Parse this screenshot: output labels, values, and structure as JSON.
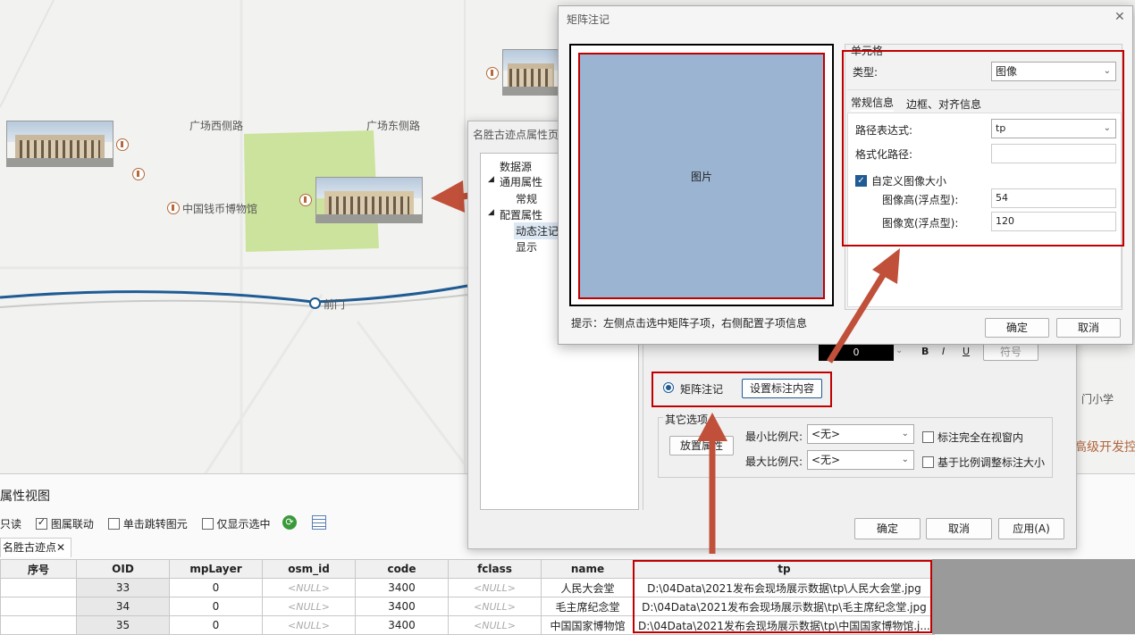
{
  "map": {
    "labels": {
      "west_road": "广场西侧路",
      "east_road": "广场东侧路",
      "museum": "中国钱币博物馆",
      "station": "前门",
      "school": "门小学",
      "adv": "高级开发控"
    }
  },
  "attr_view": {
    "title": "属性视图",
    "toolbar": {
      "readonly": "只读",
      "link": "图属联动",
      "click_jump": "单击跳转图元",
      "only_selected": "仅显示选中"
    },
    "tab": "名胜古迹点",
    "columns": [
      "序号",
      "OID",
      "mpLayer",
      "osm_id",
      "code",
      "fclass",
      "name",
      "tp"
    ],
    "rows": [
      [
        "",
        "33",
        "0",
        "<NULL>",
        "3400",
        "<NULL>",
        "人民大会堂",
        "D:\\04Data\\2021发布会现场展示数据\\tp\\人民大会堂.jpg"
      ],
      [
        "",
        "34",
        "0",
        "<NULL>",
        "3400",
        "<NULL>",
        "毛主席纪念堂",
        "D:\\04Data\\2021发布会现场展示数据\\tp\\毛主席纪念堂.jpg"
      ],
      [
        "",
        "35",
        "0",
        "<NULL>",
        "3400",
        "<NULL>",
        "中国国家博物馆",
        "D:\\04Data\\2021发布会现场展示数据\\tp\\中国国家博物馆.j..."
      ]
    ]
  },
  "prop_dialog": {
    "title": "名胜古迹点属性页",
    "tree": [
      "数据源",
      "通用属性",
      "常规",
      "配置属性",
      "动态注记",
      "显示"
    ],
    "color_value": "0",
    "symbol_btn": "符号",
    "matrix_radio": "矩阵注记",
    "set_content_btn": "设置标注内容",
    "other_options": "其它选项",
    "place_attr_btn": "放置属性",
    "min_scale_label": "最小比例尺:",
    "max_scale_label": "最大比例尺:",
    "min_scale": "<无>",
    "max_scale": "<无>",
    "label_in_window": "标注完全在视窗内",
    "scale_adjust": "基于比例调整标注大小",
    "ok": "确定",
    "cancel": "取消",
    "apply": "应用(A)"
  },
  "matrix_dialog": {
    "title": "矩阵注记",
    "cell_label": "图片",
    "hint": "提示：左侧点击选中矩阵子项，右侧配置子项信息",
    "cell_group": "单元格",
    "type_label": "类型:",
    "type_value": "图像",
    "tab_general": "常规信息",
    "tab_border": "边框、对齐信息",
    "path_expr_label": "路径表达式:",
    "path_expr_value": "tp",
    "format_path_label": "格式化路径:",
    "format_path_value": "",
    "custom_size": "自定义图像大小",
    "height_label": "图像高(浮点型):",
    "height_value": "54",
    "width_label": "图像宽(浮点型):",
    "width_value": "120",
    "ok": "确定",
    "cancel": "取消"
  },
  "colors": {
    "accent_red": "#c00000",
    "arrow": "#c0503a",
    "cell_fill": "#9ab4d2",
    "park": "#cbe39c",
    "rail": "#1f5b94"
  }
}
